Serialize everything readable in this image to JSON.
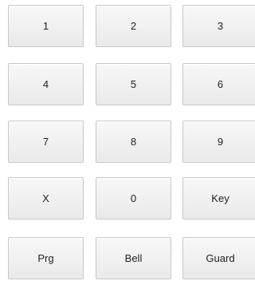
{
  "keypad": {
    "keys": {
      "k1": "1",
      "k2": "2",
      "k3": "3",
      "k4": "4",
      "k5": "5",
      "k6": "6",
      "k7": "7",
      "k8": "8",
      "k9": "9",
      "kx": "X",
      "k0": "0",
      "key": "Key",
      "prg": "Prg",
      "bell": "Bell",
      "guard": "Guard"
    }
  }
}
